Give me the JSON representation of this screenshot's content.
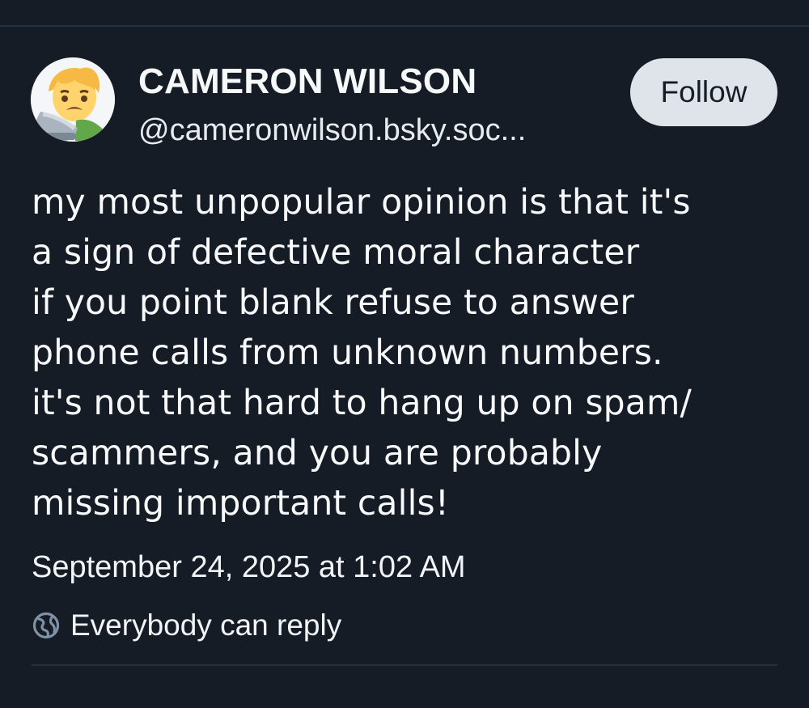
{
  "post": {
    "author": {
      "display_name": "CAMERON WILSON",
      "handle": "@cameronwilson.bsky.soc...",
      "avatar_icon": "laptop-worried-person-emoji-icon"
    },
    "follow_label": "Follow",
    "body": "my most unpopular opinion is that it's\na sign of defective moral character\nif you point blank refuse to answer\nphone calls from unknown numbers.\nit's not that hard to hang up on spam/\nscammers, and you are probably\nmissing important calls!",
    "timestamp": "September 24, 2025 at 1:02 AM",
    "reply_setting": {
      "icon": "globe-icon",
      "label": "Everybody can reply"
    }
  },
  "colors": {
    "background": "#151c25",
    "divider": "#263140",
    "follow_button": "#dfe4ea",
    "text": "#f2f4f7"
  }
}
